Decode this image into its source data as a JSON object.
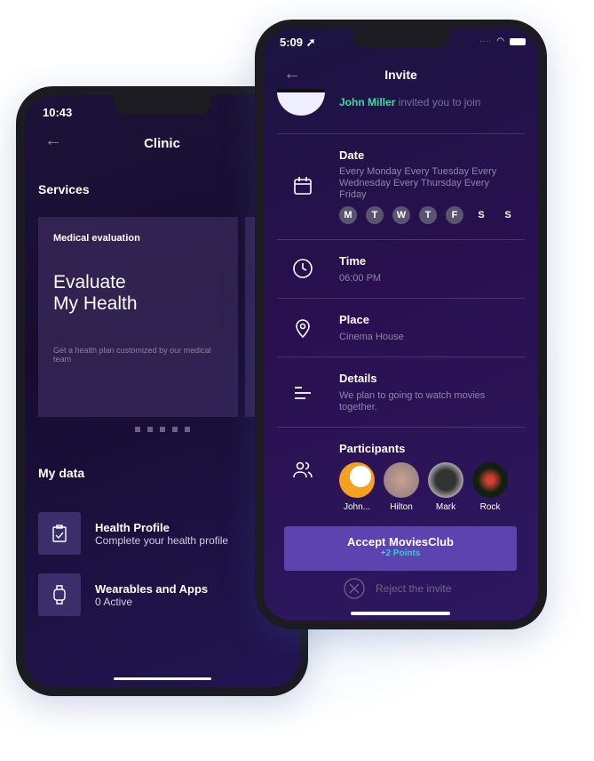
{
  "clinic": {
    "status_time": "10:43",
    "title": "Clinic",
    "services_heading": "Services",
    "card": {
      "label": "Medical evaluation",
      "headline_1": "Evaluate",
      "headline_2": "My Health",
      "description": "Get a health plan customized by our medical team"
    },
    "carousel_pages": 5,
    "my_data_heading": "My data",
    "items": [
      {
        "title": "Health Profile",
        "subtitle": "Complete your health profile",
        "icon": "clipboard-icon"
      },
      {
        "title": "Wearables and Apps",
        "subtitle": "0 Active",
        "icon": "watch-icon"
      }
    ]
  },
  "invite": {
    "status_time": "5:09",
    "title": "Invite",
    "inviter": "John Miller",
    "invite_text": " invited you to join",
    "date": {
      "label": "Date",
      "value": "Every Monday Every Tuesday Every Wednesday Every Thursday Every Friday",
      "days": [
        {
          "d": "M",
          "on": true
        },
        {
          "d": "T",
          "on": true
        },
        {
          "d": "W",
          "on": true
        },
        {
          "d": "T",
          "on": true
        },
        {
          "d": "F",
          "on": true
        },
        {
          "d": "S",
          "on": false
        },
        {
          "d": "S",
          "on": false
        }
      ]
    },
    "time": {
      "label": "Time",
      "value": "06:00 PM"
    },
    "place": {
      "label": "Place",
      "value": "Cinema House"
    },
    "details": {
      "label": "Details",
      "value": "We plan to going to watch movies together."
    },
    "participants": {
      "label": "Participants",
      "people": [
        "John...",
        "Hilton",
        "Mark",
        "Rock"
      ]
    },
    "accept_label": "Accept MoviesClub",
    "accept_points": "+2 Points",
    "reject_label": "Reject the invite",
    "colors": {
      "accent": "#5b43b0",
      "highlight": "#2ee0a0",
      "points": "#2ed0d0"
    }
  }
}
